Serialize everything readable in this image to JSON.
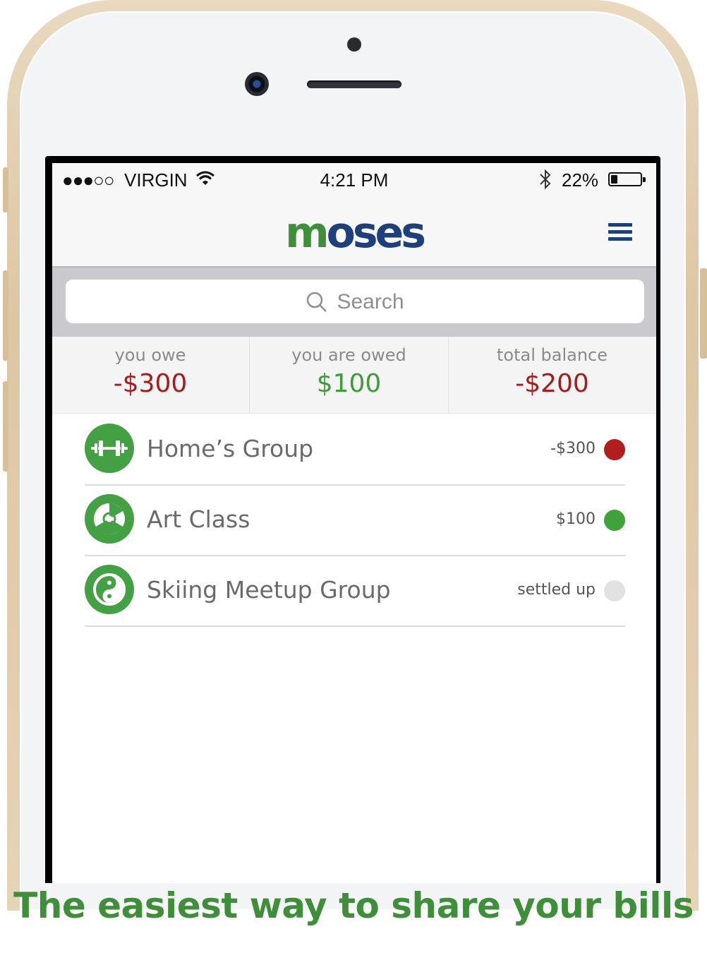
{
  "status_bar": {
    "signal": "●●●○○",
    "carrier": "VIRGIN",
    "time": "4:21 PM",
    "battery_percent": "22%",
    "battery_level": 0.22,
    "wifi_icon": "wifi-icon",
    "bluetooth_icon": "bluetooth-icon"
  },
  "header": {
    "logo_part1": "m",
    "logo_part2": "oses",
    "menu_icon": "hamburger-menu-icon"
  },
  "search": {
    "placeholder": "Search"
  },
  "summary": {
    "you_owe_label": "you owe",
    "you_owe_value": "-$300",
    "you_are_owed_label": "you are owed",
    "you_are_owed_value": "$100",
    "total_balance_label": "total balance",
    "total_balance_value": "-$200"
  },
  "groups": [
    {
      "name": "Home’s Group",
      "amount": "-$300",
      "icon": "dumbbell-icon",
      "status_color": "#b01e1e"
    },
    {
      "name": "Art Class",
      "amount": "$100",
      "icon": "radiation-icon",
      "status_color": "#3fa33a"
    },
    {
      "name": "Skiing Meetup Group",
      "amount": "settled up",
      "icon": "yin-yang-icon",
      "status_color": "#e2e2e2"
    }
  ],
  "colors": {
    "brand_green": "#3f8f3a",
    "brand_blue": "#1d3f7a",
    "negative": "#a61c1c",
    "positive": "#3f9b3a"
  },
  "tagline": "The easiest way to share your bills"
}
